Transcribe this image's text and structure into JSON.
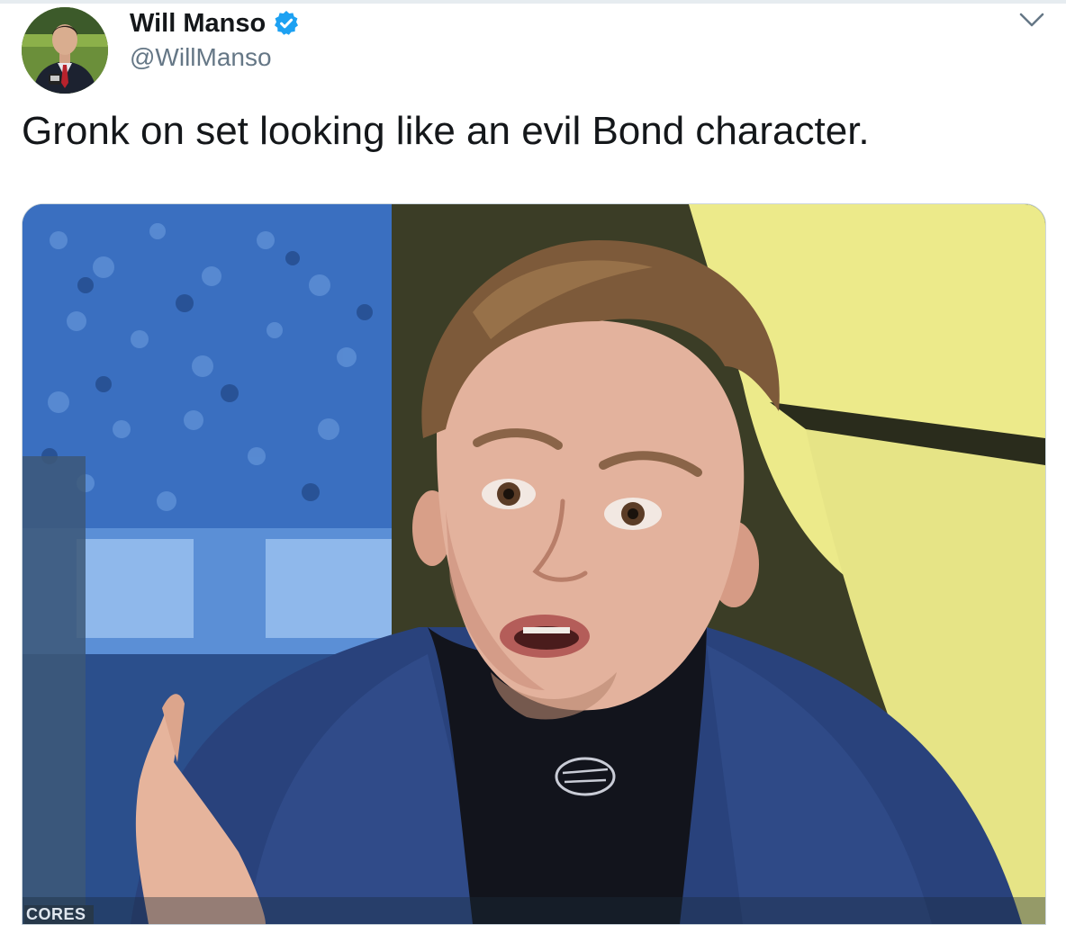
{
  "tweet": {
    "author": {
      "display_name": "Will Manso",
      "handle": "@WillManso",
      "verified": true
    },
    "text": "Gronk on set looking like an evil Bond character.",
    "media": {
      "overlay_text": "CORES"
    }
  },
  "colors": {
    "text_primary": "#14171a",
    "text_secondary": "#657786",
    "verified_blue": "#1da1f2",
    "border": "#ccd6dd"
  },
  "icons": {
    "verified": "verified-badge-icon",
    "menu": "chevron-down-icon"
  }
}
